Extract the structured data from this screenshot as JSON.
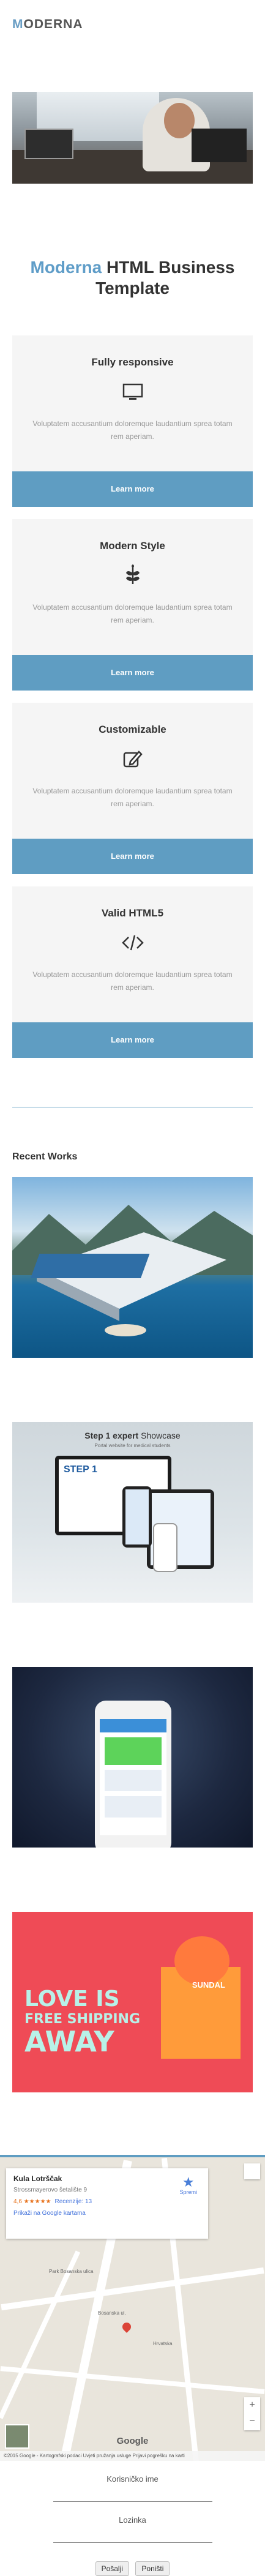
{
  "header": {
    "logo_first": "M",
    "logo_rest": "ODERNA"
  },
  "title": {
    "accent": "Moderna",
    "rest": "HTML Business Template"
  },
  "features": [
    {
      "heading": "Fully responsive",
      "icon": "monitor-icon",
      "text": "Voluptatem accusantium doloremque laudantium sprea totam rem aperiam.",
      "button": "Learn more"
    },
    {
      "heading": "Modern Style",
      "icon": "leaf-icon",
      "text": "Voluptatem accusantium doloremque laudantium sprea totam rem aperiam.",
      "button": "Learn more"
    },
    {
      "heading": "Customizable",
      "icon": "edit-icon",
      "text": "Voluptatem accusantium doloremque laudantium sprea totam rem aperiam.",
      "button": "Learn more"
    },
    {
      "heading": "Valid HTML5",
      "icon": "code-icon",
      "text": "Voluptatem accusantium doloremque laudantium sprea totam rem aperiam.",
      "button": "Learn more"
    }
  ],
  "recent": {
    "title": "Recent Works",
    "works": [
      {
        "caption": ""
      },
      {
        "caption_bold": "Step 1 expert",
        "caption_rest": "Showcase",
        "subcaption": "Portal website for medical students",
        "brand": "STEP 1"
      },
      {
        "caption": ""
      },
      {
        "line1": "LOVE IS",
        "line2": "FREE SHIPPING",
        "line3": "AWAY",
        "brand": "SUNDAL"
      }
    ]
  },
  "map": {
    "place": "Kula Lotrščak",
    "address": "Strossmayerovo šetalište 9",
    "rating": "4,6 ★★★★★",
    "reviews": "Recenzije: 13",
    "bigger_map": "Prikaži na Google kartama",
    "save": "Spremi",
    "google": "Google",
    "footer": "©2015 Google - Kartografski podaci   Uvjeti pružanja usluge   Prijavi pogrešku na karti",
    "labels": [
      "Park Bosanska ulica",
      "Hrvatska",
      "Bosanska ul."
    ]
  },
  "login": {
    "user_label": "Korisničko ime",
    "pass_label": "Lozinka",
    "submit": "Pošalji",
    "reset": "Poništi"
  },
  "colors": {
    "accent": "#5f9dc2",
    "feature_bg": "#f5f5f5"
  }
}
